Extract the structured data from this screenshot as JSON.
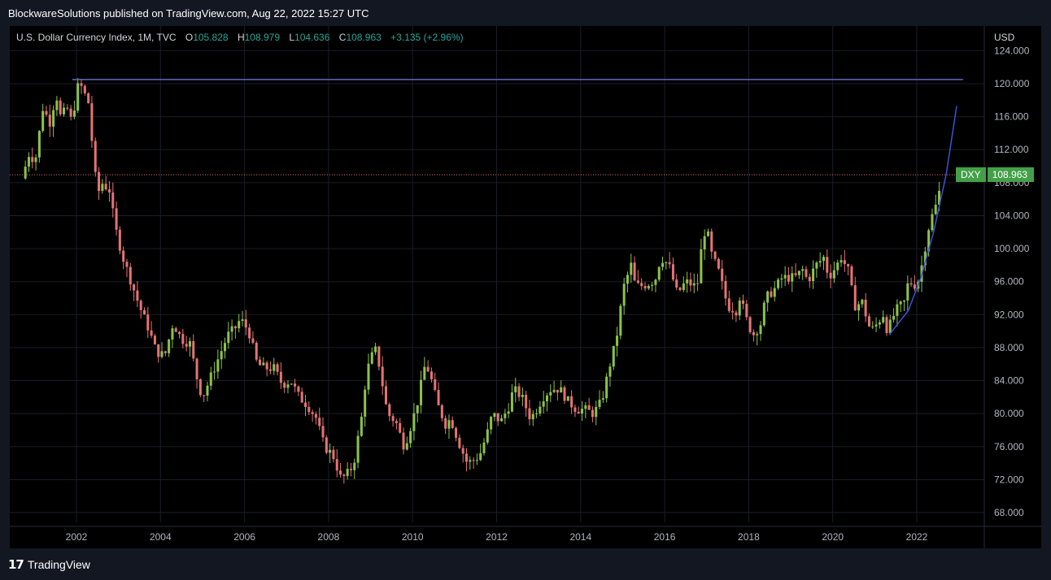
{
  "header": {
    "publisher": "BlockwareSolutions published on TradingView.com, Aug 22, 2022 15:27 UTC"
  },
  "legend": {
    "symbol": "U.S. Dollar Currency Index, 1M, TVC",
    "o_label": "O",
    "o_value": "105.828",
    "h_label": "H",
    "h_value": "108.979",
    "l_label": "L",
    "l_value": "104.636",
    "c_label": "C",
    "c_value": "108.963",
    "change": "+3.135 (+2.96%)"
  },
  "axis": {
    "currency": "USD"
  },
  "last_price": {
    "symbol": "DXY",
    "value": "108.963"
  },
  "footer": {
    "logo_mark": "17",
    "logo_text": "TradingView"
  },
  "colors": {
    "up": "#8bc34a",
    "down": "#e57373",
    "resistance": "#5c6bc0",
    "curve": "#3f51d8",
    "last_price_bg": "#43a047",
    "price_line": "#e57373"
  },
  "chart_data": {
    "type": "candlestick",
    "title": "U.S. Dollar Currency Index, 1M, TVC",
    "interval": "1M",
    "ylabel": "USD",
    "ylim": [
      66,
      126
    ],
    "xlim": [
      2000.6,
      2023.8
    ],
    "y_ticks": [
      "124.000",
      "120.000",
      "116.000",
      "112.000",
      "108.000",
      "104.000",
      "100.000",
      "96.000",
      "92.000",
      "88.000",
      "84.000",
      "80.000",
      "76.000",
      "72.000",
      "68.000"
    ],
    "y_tick_values": [
      124,
      120,
      116,
      112,
      108,
      104,
      100,
      96,
      92,
      88,
      84,
      80,
      76,
      72,
      68
    ],
    "x_ticks": [
      "2002",
      "2004",
      "2006",
      "2008",
      "2010",
      "2012",
      "2014",
      "2016",
      "2018",
      "2020",
      "2022"
    ],
    "x_tick_values": [
      2002,
      2004,
      2006,
      2008,
      2010,
      2012,
      2014,
      2016,
      2018,
      2020,
      2022
    ],
    "close_path": [
      [
        2000.7,
        108.5
      ],
      [
        2000.9,
        112
      ],
      [
        2001.0,
        110
      ],
      [
        2001.2,
        117
      ],
      [
        2001.4,
        115
      ],
      [
        2001.5,
        119.5
      ],
      [
        2001.6,
        116
      ],
      [
        2001.8,
        117
      ],
      [
        2001.9,
        115
      ],
      [
        2002.0,
        119.5
      ],
      [
        2002.1,
        119.8
      ],
      [
        2002.3,
        117.5
      ],
      [
        2002.4,
        111
      ],
      [
        2002.5,
        106.5
      ],
      [
        2002.6,
        108
      ],
      [
        2002.8,
        107
      ],
      [
        2002.9,
        103
      ],
      [
        2003.1,
        99
      ],
      [
        2003.3,
        96
      ],
      [
        2003.5,
        93
      ],
      [
        2003.7,
        90.5
      ],
      [
        2003.9,
        87.5
      ],
      [
        2004.1,
        87
      ],
      [
        2004.3,
        91
      ],
      [
        2004.5,
        89
      ],
      [
        2004.7,
        88.5
      ],
      [
        2004.9,
        83.5
      ],
      [
        2005.0,
        82
      ],
      [
        2005.2,
        84.5
      ],
      [
        2005.4,
        87
      ],
      [
        2005.6,
        89.5
      ],
      [
        2005.8,
        90.5
      ],
      [
        2005.9,
        91.5
      ],
      [
        2006.1,
        90
      ],
      [
        2006.3,
        86
      ],
      [
        2006.5,
        85.5
      ],
      [
        2006.7,
        85.5
      ],
      [
        2006.9,
        83.5
      ],
      [
        2007.1,
        84
      ],
      [
        2007.3,
        82
      ],
      [
        2007.5,
        81
      ],
      [
        2007.7,
        79.5
      ],
      [
        2007.9,
        76
      ],
      [
        2008.1,
        75
      ],
      [
        2008.3,
        72
      ],
      [
        2008.5,
        73
      ],
      [
        2008.6,
        74
      ],
      [
        2008.8,
        80
      ],
      [
        2008.9,
        85
      ],
      [
        2009.1,
        88
      ],
      [
        2009.2,
        86
      ],
      [
        2009.4,
        80
      ],
      [
        2009.6,
        79
      ],
      [
        2009.8,
        76
      ],
      [
        2009.9,
        77.5
      ],
      [
        2010.1,
        81
      ],
      [
        2010.3,
        86
      ],
      [
        2010.4,
        85
      ],
      [
        2010.6,
        81
      ],
      [
        2010.8,
        78.5
      ],
      [
        2010.9,
        79.5
      ],
      [
        2011.1,
        76.5
      ],
      [
        2011.3,
        74
      ],
      [
        2011.5,
        74.5
      ],
      [
        2011.6,
        75
      ],
      [
        2011.8,
        78
      ],
      [
        2011.9,
        80
      ],
      [
        2012.1,
        79
      ],
      [
        2012.3,
        81
      ],
      [
        2012.4,
        83
      ],
      [
        2012.6,
        82
      ],
      [
        2012.8,
        79.5
      ],
      [
        2012.9,
        80
      ],
      [
        2013.1,
        82
      ],
      [
        2013.3,
        83
      ],
      [
        2013.5,
        83
      ],
      [
        2013.7,
        81.5
      ],
      [
        2013.9,
        80.5
      ],
      [
        2014.1,
        80.5
      ],
      [
        2014.3,
        80
      ],
      [
        2014.5,
        81.5
      ],
      [
        2014.7,
        86
      ],
      [
        2014.8,
        88
      ],
      [
        2014.9,
        90.5
      ],
      [
        2015.0,
        95
      ],
      [
        2015.2,
        98
      ],
      [
        2015.3,
        95.5
      ],
      [
        2015.5,
        95.5
      ],
      [
        2015.7,
        96
      ],
      [
        2015.8,
        96.5
      ],
      [
        2015.9,
        99
      ],
      [
        2016.1,
        98
      ],
      [
        2016.3,
        94.5
      ],
      [
        2016.5,
        96
      ],
      [
        2016.7,
        95.5
      ],
      [
        2016.8,
        96
      ],
      [
        2016.9,
        101.5
      ],
      [
        2017.0,
        102.5
      ],
      [
        2017.1,
        99.5
      ],
      [
        2017.3,
        97
      ],
      [
        2017.5,
        93
      ],
      [
        2017.7,
        92.5
      ],
      [
        2017.8,
        94.5
      ],
      [
        2017.9,
        92
      ],
      [
        2018.1,
        89.5
      ],
      [
        2018.3,
        91
      ],
      [
        2018.4,
        94
      ],
      [
        2018.6,
        95
      ],
      [
        2018.8,
        96.5
      ],
      [
        2018.9,
        96.5
      ],
      [
        2019.1,
        96.5
      ],
      [
        2019.3,
        97.5
      ],
      [
        2019.4,
        96
      ],
      [
        2019.6,
        98
      ],
      [
        2019.8,
        99
      ],
      [
        2019.9,
        96.5
      ],
      [
        2020.1,
        98
      ],
      [
        2020.2,
        99
      ],
      [
        2020.4,
        97
      ],
      [
        2020.5,
        93
      ],
      [
        2020.7,
        93.5
      ],
      [
        2020.9,
        90
      ],
      [
        2021.0,
        90.5
      ],
      [
        2021.2,
        92
      ],
      [
        2021.3,
        90
      ],
      [
        2021.5,
        92.5
      ],
      [
        2021.7,
        93.5
      ],
      [
        2021.8,
        96
      ],
      [
        2022.0,
        95.5
      ],
      [
        2022.1,
        97.5
      ],
      [
        2022.3,
        103
      ],
      [
        2022.4,
        104.5
      ],
      [
        2022.5,
        105.8
      ],
      [
        2022.6,
        108.96
      ]
    ],
    "resistance_level": 120.5,
    "resistance_range": [
      2001.9,
      2023.1
    ],
    "curve": [
      [
        2021.35,
        89.6
      ],
      [
        2021.8,
        92.5
      ],
      [
        2022.1,
        96.5
      ],
      [
        2022.4,
        102
      ],
      [
        2022.7,
        109
      ],
      [
        2022.95,
        117.3
      ]
    ],
    "last_close": 108.963
  }
}
